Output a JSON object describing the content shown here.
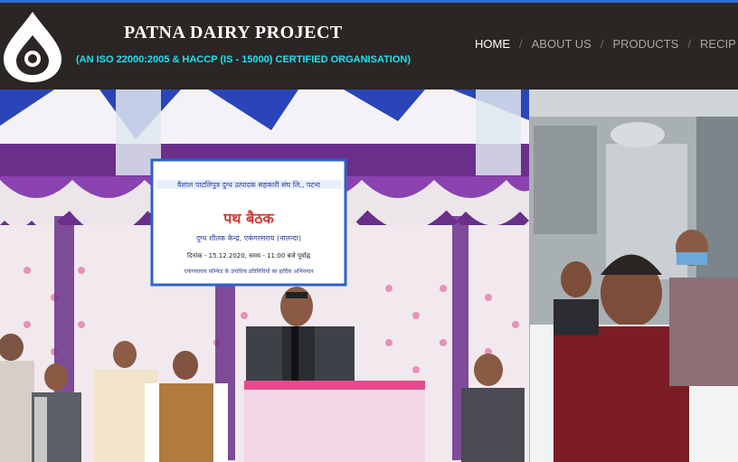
{
  "site": {
    "title": "PATNA DAIRY PROJECT",
    "subtitle": "(AN ISO 22000:2005 & HACCP (IS - 15000) CERTIFIED ORGANISATION)",
    "logo": "drop-logo-icon"
  },
  "nav": {
    "items": [
      {
        "label": "HOME",
        "active": true
      },
      {
        "label": "ABOUT US",
        "active": false
      },
      {
        "label": "PRODUCTS",
        "active": false
      },
      {
        "label": "RECIP",
        "active": false
      }
    ],
    "separator": "/"
  },
  "hero": {
    "banner": {
      "line1": "वैशाल पाटलिपुत्र दुग्ध उत्पादक सहकारी संघ लि., पटना",
      "line2": "पथ बैठक",
      "line3": "दुग्ध शीतक केन्द्र, एकंगरसराय (नालन्दा)",
      "line4": "दिनांक - 15.12.2020, समय - 11:00 बजे पूर्वाह्न",
      "line5": "एकंगरसराय कॉम्फेड के उपाधिक प्रतिनिधियों का हार्दिक अभिनन्दन"
    }
  },
  "colors": {
    "header_bg": "#2b2624",
    "accent_line": "#2f6fd0",
    "subtitle": "#1ee0f0",
    "nav_active": "#ffffff",
    "nav_inactive": "#a9a6a4"
  }
}
